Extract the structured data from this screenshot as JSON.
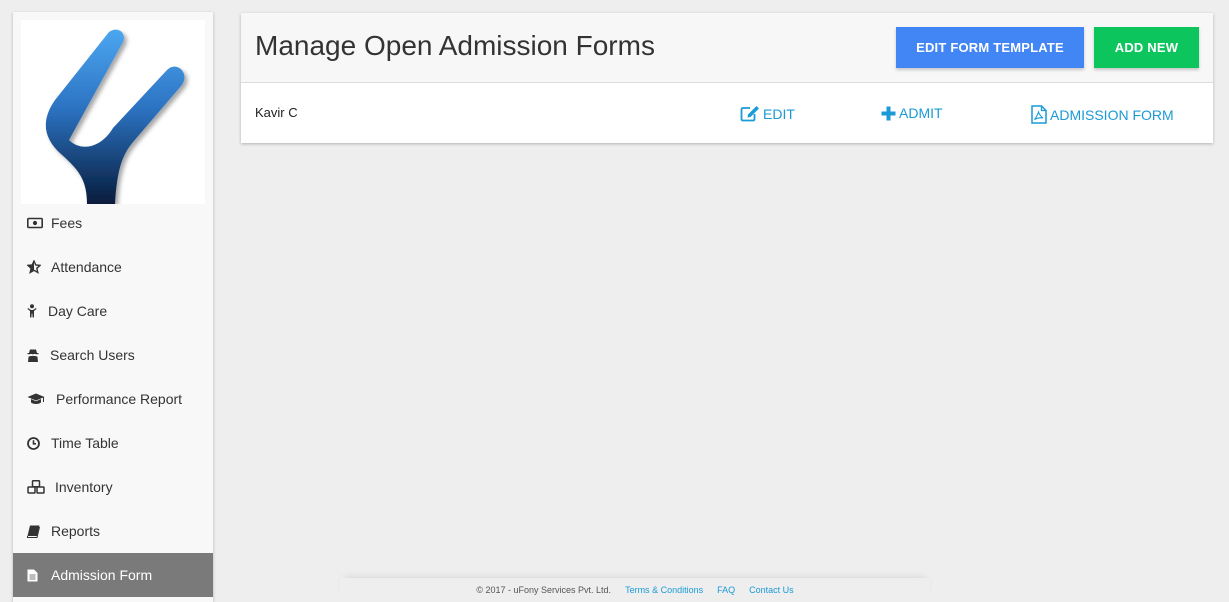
{
  "colors": {
    "primary_button": "#4285f4",
    "success_button": "#0cc55c",
    "link": "#1a9ad6",
    "logo_top": "#4ca6f0",
    "logo_bottom": "#0a2044",
    "active_nav": "#7a7a7a"
  },
  "sidebar": {
    "items": [
      {
        "label": "Fees",
        "icon": "money-icon"
      },
      {
        "label": "Attendance",
        "icon": "star-half-icon"
      },
      {
        "label": "Day Care",
        "icon": "child-icon"
      },
      {
        "label": "Search Users",
        "icon": "user-secret-icon"
      },
      {
        "label": "Performance Report",
        "icon": "graduation-cap-icon"
      },
      {
        "label": "Time Table",
        "icon": "clock-icon"
      },
      {
        "label": "Inventory",
        "icon": "cubes-icon"
      },
      {
        "label": "Reports",
        "icon": "book-icon"
      },
      {
        "label": "Admission Form",
        "icon": "file-text-icon",
        "active": true
      }
    ]
  },
  "header": {
    "title": "Manage Open Admission Forms",
    "edit_template_label": "EDIT FORM TEMPLATE",
    "add_new_label": "ADD NEW"
  },
  "rows": [
    {
      "name": "Kavir C",
      "edit_label": "EDIT",
      "admit_label": "ADMIT",
      "form_label": "ADMISSION FORM"
    }
  ],
  "footer": {
    "copyright": "© 2017 - uFony Services Pvt. Ltd.",
    "links": [
      "Terms & Conditions",
      "FAQ",
      "Contact Us"
    ]
  }
}
